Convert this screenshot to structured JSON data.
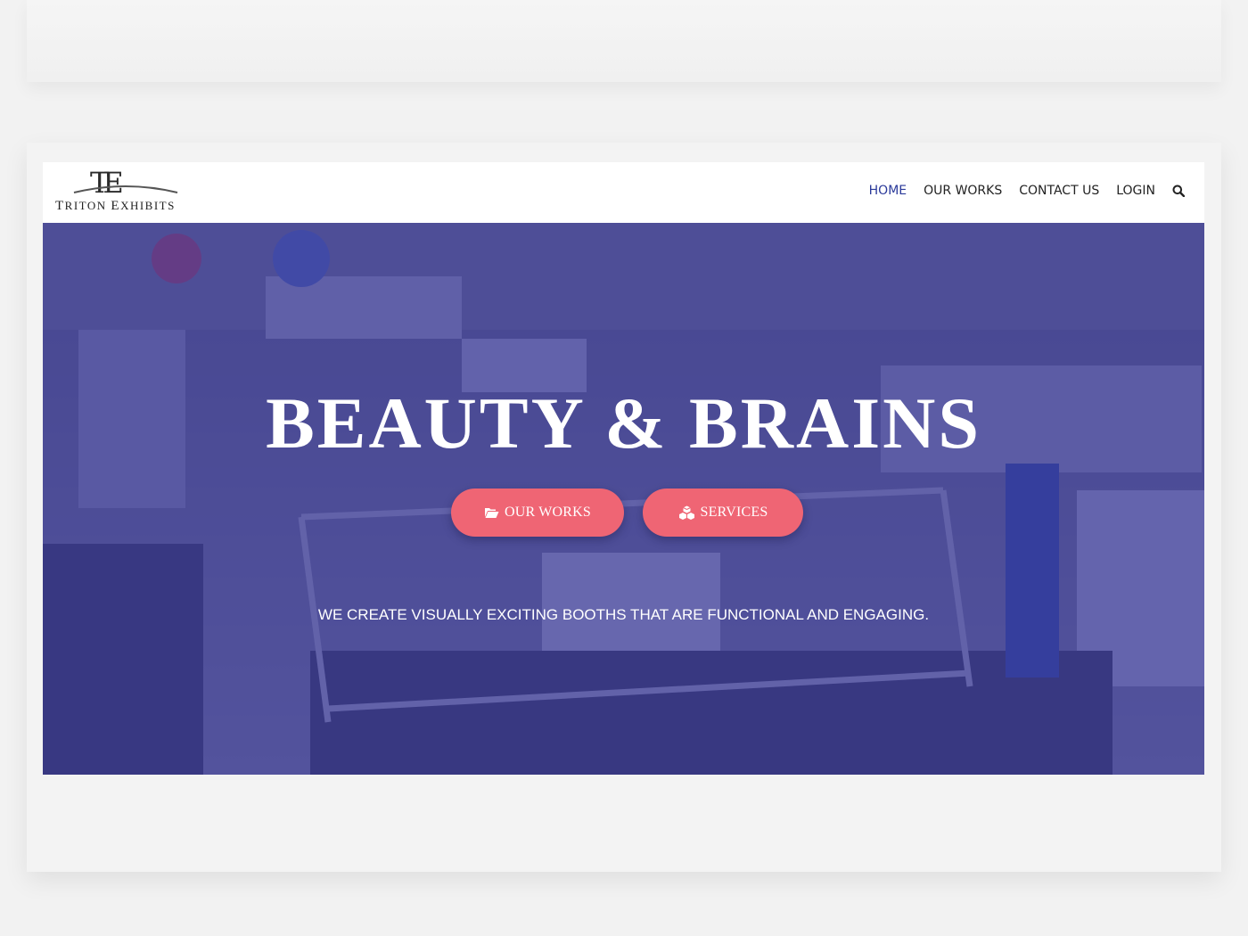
{
  "logo": {
    "monogram": "TE",
    "wordmark_first": "T",
    "wordmark_first_rest": "RITON",
    "wordmark_second": "E",
    "wordmark_second_rest": "XHIBITS"
  },
  "nav": {
    "items": [
      {
        "label": "HOME",
        "active": true
      },
      {
        "label": "OUR WORKS",
        "active": false
      },
      {
        "label": "CONTACT US",
        "active": false
      },
      {
        "label": "LOGIN",
        "active": false
      }
    ],
    "search_icon": "search-icon"
  },
  "hero": {
    "headline": "BEAUTY & BRAINS",
    "buttons": [
      {
        "label": "OUR WORKS",
        "icon": "folder-open-icon"
      },
      {
        "label": "SERVICES",
        "icon": "cubes-icon"
      }
    ],
    "tagline": "WE CREATE VISUALLY EXCITING BOOTHS THAT ARE FUNCTIONAL AND ENGAGING."
  },
  "colors": {
    "nav_active": "#2b3a9a",
    "button_bg": "#ef6574",
    "hero_overlay": "#3737a0"
  }
}
